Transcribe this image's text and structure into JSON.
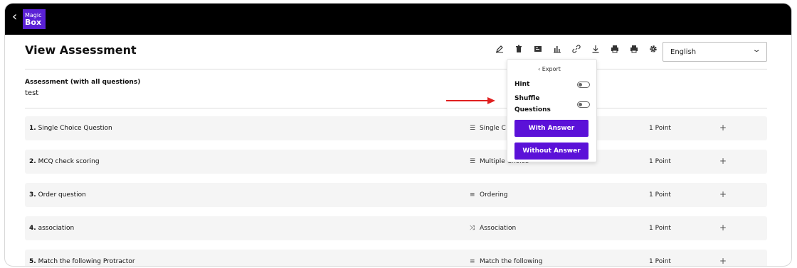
{
  "header": {
    "back_icon": "chevron-left-icon",
    "logo_line1": "Magic",
    "logo_line2": "Box",
    "brand_color": "#5b21d6"
  },
  "page": {
    "title": "View Assessment",
    "language": "English"
  },
  "toolbar": {
    "icons": [
      "pencil-icon",
      "delete-icon",
      "preview-icon",
      "chart-icon",
      "link-icon",
      "download-icon",
      "print-icon",
      "print-icon",
      "gear-icon"
    ]
  },
  "assessment": {
    "label": "Assessment (with all questions)",
    "value": "test"
  },
  "export_menu": {
    "back_label": "Export",
    "hint_label": "Hint",
    "shuffle_label_line1": "Shuffle",
    "shuffle_label_line2": "Questions",
    "hint_enabled": false,
    "shuffle_enabled": false,
    "with_answer_label": "With Answer",
    "without_answer_label": "Without Answer",
    "button_color": "#5b11d8"
  },
  "questions": [
    {
      "num": "1.",
      "title": "Single Choice Question",
      "type": "Single C",
      "points": "1 Point"
    },
    {
      "num": "2.",
      "title": "MCQ check scoring",
      "type": "Multiple Choice",
      "points": "1 Point"
    },
    {
      "num": "3.",
      "title": "Order question",
      "type": "Ordering",
      "points": "1 Point"
    },
    {
      "num": "4.",
      "title": "association",
      "type": "Association",
      "points": "1 Point"
    },
    {
      "num": "5.",
      "title": "Match the following Protractor",
      "type": "Match the following",
      "points": "1 Point"
    }
  ],
  "annotation": {
    "arrow_color": "#e02020"
  }
}
